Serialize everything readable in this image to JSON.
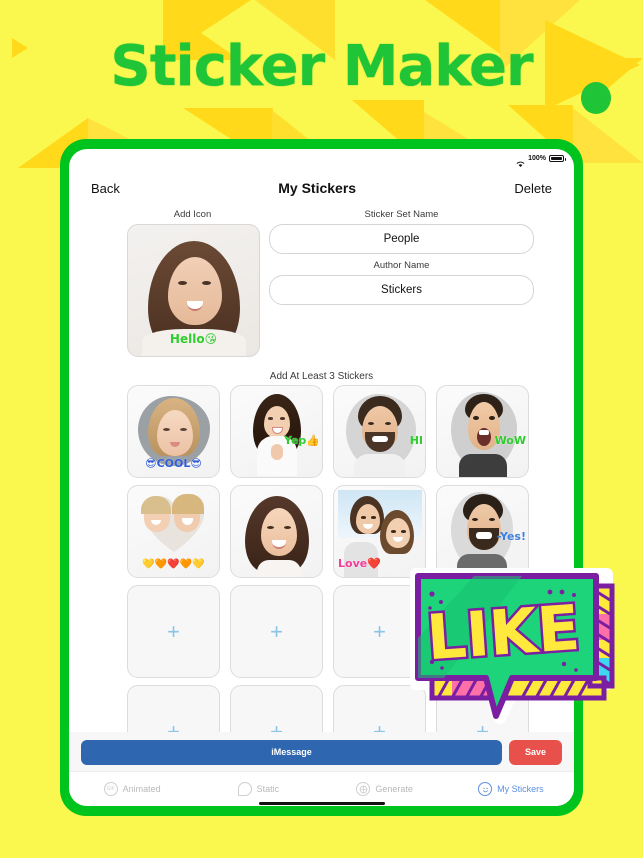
{
  "app": {
    "title": "Sticker Maker",
    "brand_green": "#1FC437",
    "background_yellow": "#FAF84E",
    "accent_blue": "#2E66B0",
    "accent_red": "#E8504C",
    "tab_active_blue": "#5D8FE0"
  },
  "statusbar": {
    "wifi_icon": "wifi-icon",
    "battery_percent": "100%",
    "battery_icon": "battery-icon"
  },
  "navbar": {
    "back_label": "Back",
    "title": "My Stickers",
    "delete_label": "Delete"
  },
  "form": {
    "icon_caption": "Add Icon",
    "icon_sticker_text": "Hello😘",
    "set_name_caption": "Sticker Set Name",
    "set_name_value": "People",
    "author_caption": "Author Name",
    "author_value": "Stickers"
  },
  "grid": {
    "title": "Add At Least 3 Stickers",
    "add_icon": "plus-icon",
    "cells": [
      {
        "type": "filled",
        "name": "sticker-cool",
        "label": "😎COOL😎",
        "label_color": "#2F5BD6",
        "label_pos": "bottom"
      },
      {
        "type": "filled",
        "name": "sticker-yep",
        "label": "Yep👍",
        "label_color": "#2ECC2E",
        "label_pos": "side"
      },
      {
        "type": "filled",
        "name": "sticker-hi",
        "label": "HI",
        "label_color": "#2ECC2E",
        "label_pos": "side"
      },
      {
        "type": "filled",
        "name": "sticker-wow",
        "label": "WoW",
        "label_color": "#2ECC2E",
        "label_pos": "side"
      },
      {
        "type": "filled",
        "name": "sticker-hearts",
        "label": "💛🧡❤️🧡💛",
        "label_color": "#E8A33D",
        "label_pos": "bottom"
      },
      {
        "type": "filled",
        "name": "sticker-portrait",
        "label": "",
        "label_color": "#000000",
        "label_pos": "bottom"
      },
      {
        "type": "filled",
        "name": "sticker-love",
        "label": "Love❤️",
        "label_color": "#F23D9B",
        "label_pos": "bottom"
      },
      {
        "type": "filled",
        "name": "sticker-yes",
        "label": "-Yes!",
        "label_color": "#3C7FE0",
        "label_pos": "side"
      },
      {
        "type": "empty",
        "name": "sticker-slot-9",
        "label": "+",
        "label_color": "#8CC4E8",
        "label_pos": "center"
      },
      {
        "type": "empty",
        "name": "sticker-slot-10",
        "label": "+",
        "label_color": "#8CC4E8",
        "label_pos": "center"
      },
      {
        "type": "empty",
        "name": "sticker-slot-11",
        "label": "+",
        "label_color": "#8CC4E8",
        "label_pos": "center"
      },
      {
        "type": "empty",
        "name": "sticker-slot-12",
        "label": "+",
        "label_color": "#8CC4E8",
        "label_pos": "center"
      },
      {
        "type": "empty",
        "name": "sticker-slot-13",
        "label": "+",
        "label_color": "#8CC4E8",
        "label_pos": "center"
      },
      {
        "type": "empty",
        "name": "sticker-slot-14",
        "label": "+",
        "label_color": "#8CC4E8",
        "label_pos": "center"
      },
      {
        "type": "empty",
        "name": "sticker-slot-15",
        "label": "+",
        "label_color": "#8CC4E8",
        "label_pos": "center"
      },
      {
        "type": "empty",
        "name": "sticker-slot-16",
        "label": "+",
        "label_color": "#8CC4E8",
        "label_pos": "center"
      }
    ]
  },
  "bottombar": {
    "imessage_label": "iMessage",
    "save_label": "Save"
  },
  "tabbar": {
    "tabs": [
      {
        "label": "Animated",
        "icon": "gif-icon",
        "active": false
      },
      {
        "label": "Static",
        "icon": "bubble-icon",
        "active": false
      },
      {
        "label": "Generate",
        "icon": "generate-icon",
        "active": false
      },
      {
        "label": "My Stickers",
        "icon": "smiley-icon",
        "active": true
      }
    ]
  },
  "overlay_sticker": {
    "name": "like-sticker",
    "text": "LIKE",
    "fill": "#1ED47B",
    "outline": "#7B1FA2",
    "text_fill": "#FFE93D"
  }
}
